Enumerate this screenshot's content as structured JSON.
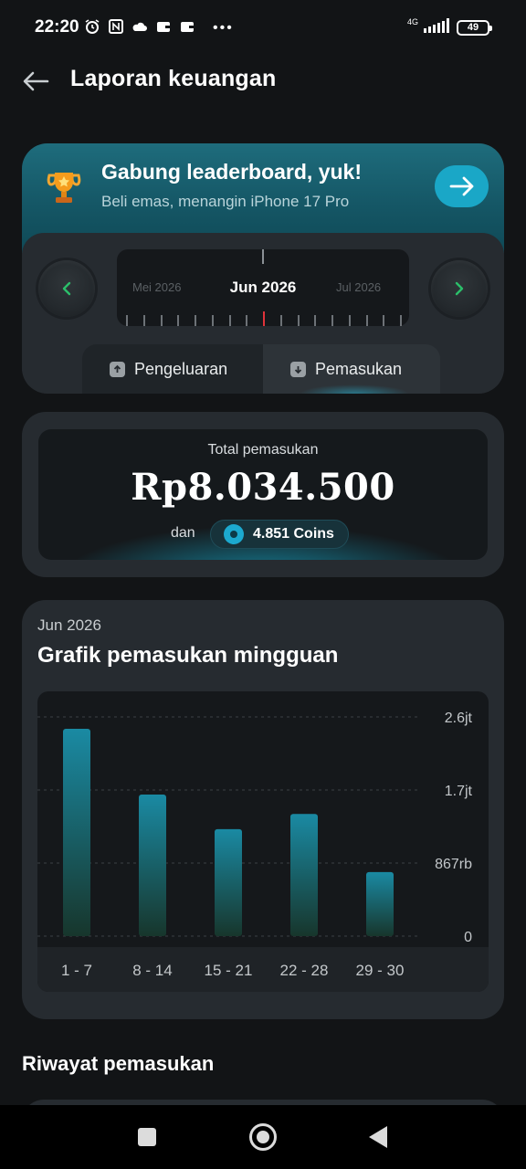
{
  "status_bar": {
    "time": "22:20",
    "network": "4G",
    "battery": "49"
  },
  "header": {
    "title": "Laporan keuangan"
  },
  "leaderboard": {
    "title": "Gabung leaderboard, yuk!",
    "subtitle": "Beli emas, menangin iPhone 17 Pro"
  },
  "month_picker": {
    "prev_month": "Mei 2026",
    "current_month": "Jun 2026",
    "next_month": "Jul 2026"
  },
  "tabs": {
    "expense_label": "Pengeluaran",
    "income_label": "Pemasukan",
    "active": "Pemasukan"
  },
  "total": {
    "label": "Total pemasukan",
    "amount": "Rp8.034.500",
    "connector": "dan",
    "coins": "4.851 Coins"
  },
  "chart_section": {
    "month": "Jun 2026",
    "title": "Grafik pemasukan mingguan"
  },
  "chart_data": {
    "type": "bar",
    "categories": [
      "1 - 7",
      "8 - 14",
      "15 - 21",
      "22 - 28",
      "29 - 30"
    ],
    "values": [
      2460000,
      1680000,
      1270000,
      1450000,
      760000
    ],
    "ytick_labels": [
      "0",
      "867rb",
      "1.7jt",
      "2.6jt"
    ],
    "ytick_values": [
      0,
      867000,
      1734000,
      2601000
    ],
    "ylim": [
      0,
      2601000
    ],
    "grid": true,
    "colors": {
      "bar_top": "#1a8aa3",
      "bar_bottom": "#17362c"
    }
  },
  "history": {
    "title": "Riwayat pemasukan"
  },
  "colors": {
    "accent": "#1aa7c7",
    "background": "#121416",
    "card": "#262b30",
    "tick_marker": "#e0333a",
    "nav_arrow_green": "#2bbf6a"
  }
}
